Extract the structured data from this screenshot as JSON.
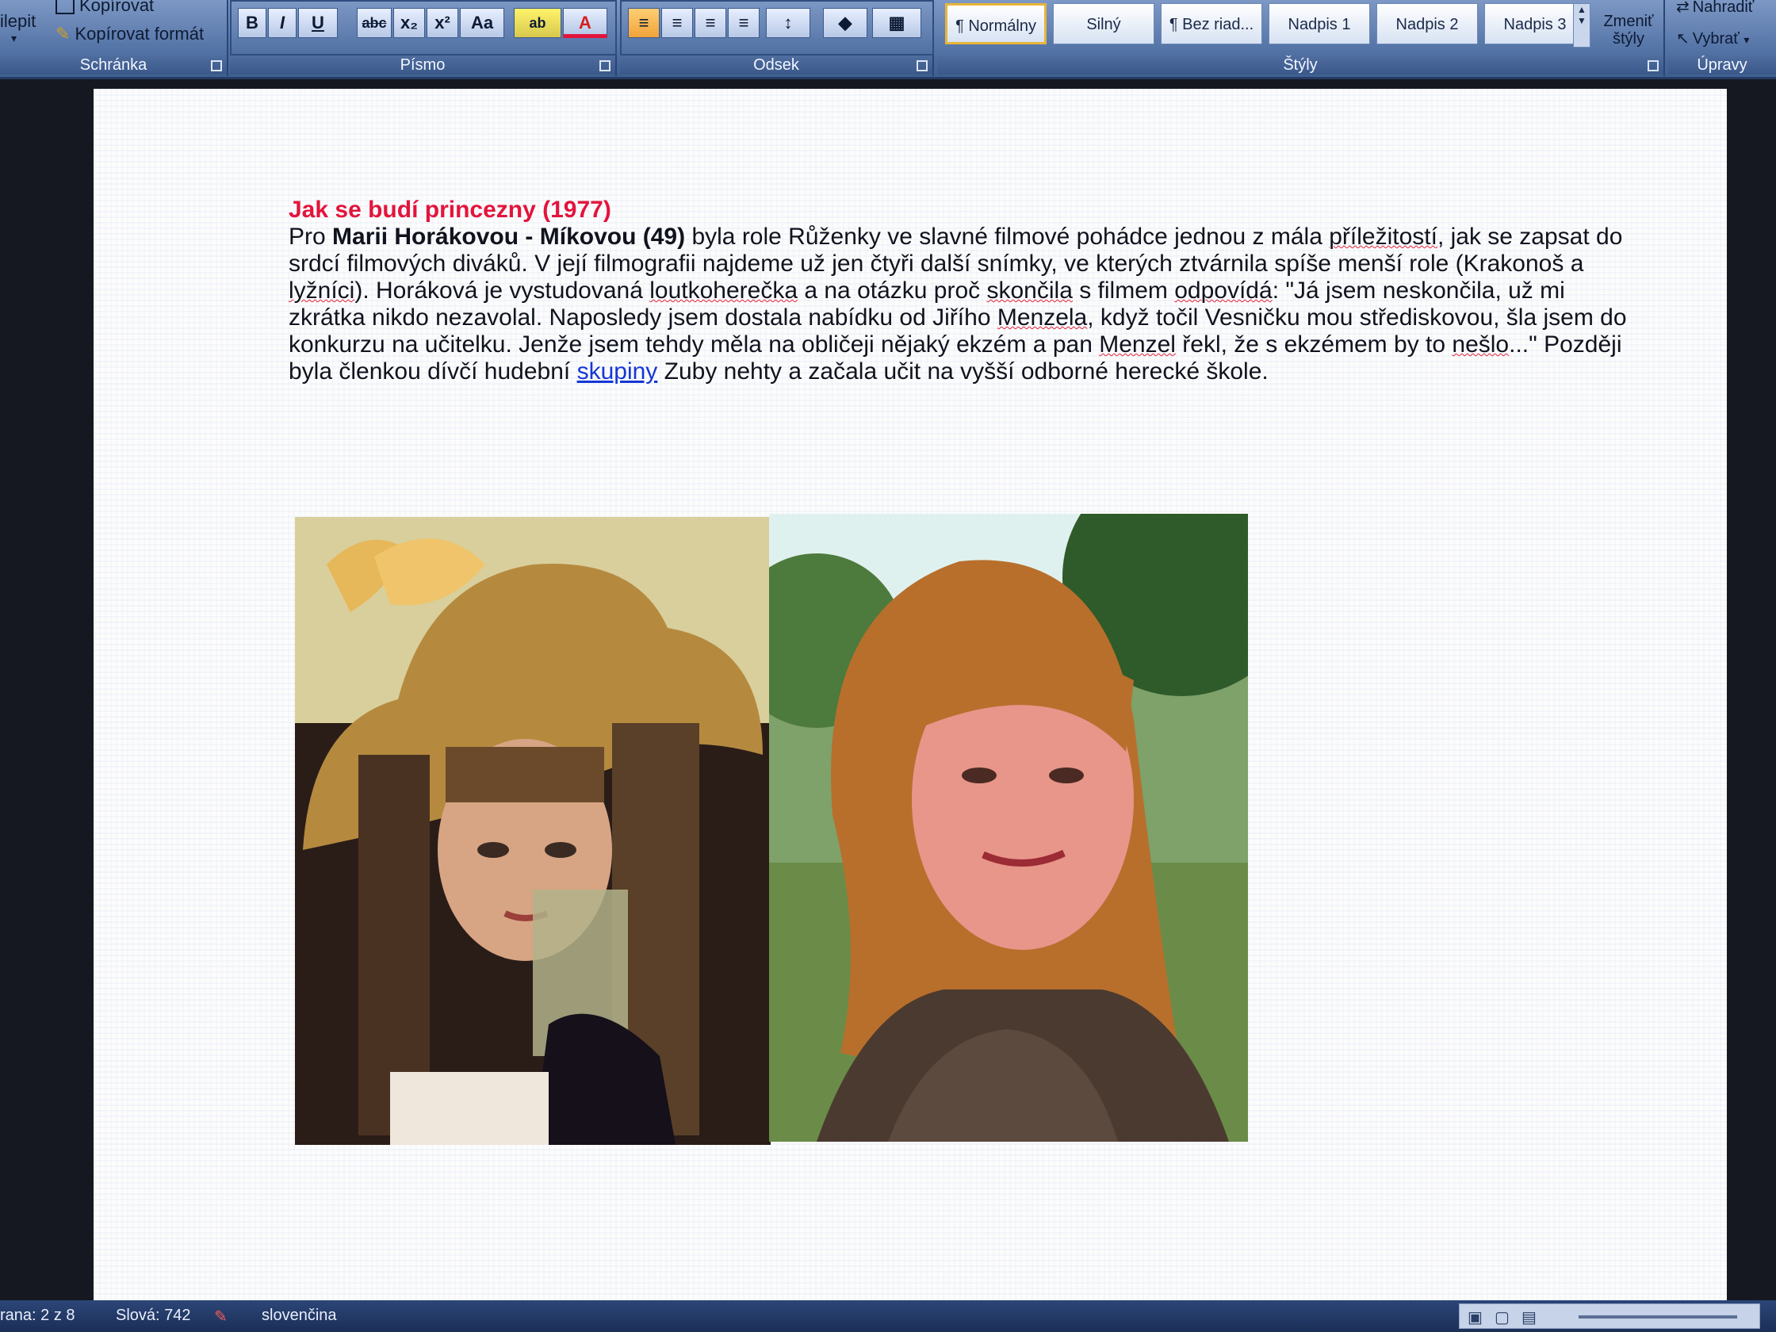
{
  "ribbon": {
    "clipboard": {
      "paste_label": "ilepit",
      "copy_label": "Kopírovat",
      "format_painter_label": "Kopírovat formát",
      "group_label": "Schránka"
    },
    "font": {
      "bold": "B",
      "italic": "I",
      "underline": "U",
      "strikethrough": "abc",
      "subscript": "x₂",
      "superscript": "x²",
      "change_case": "Aa",
      "highlight": "ab",
      "font_color": "A",
      "group_label": "Písmo"
    },
    "paragraph": {
      "group_label": "Odsek"
    },
    "styles": {
      "items": [
        "¶ Normálny",
        "Silný",
        "¶ Bez riad...",
        "Nadpis 1",
        "Nadpis 2",
        "Nadpis 3"
      ],
      "change_styles_label": "Zmeniť štýly",
      "group_label": "Štýly"
    },
    "editing": {
      "replace_label": "Nahradiť",
      "select_label": "Vybrať",
      "group_label": "Úpravy"
    }
  },
  "document": {
    "heading": "Jak se budí princezny (1977)",
    "t1": "Pro ",
    "b1": "Marii Horákovou - Míkovou (49)",
    "t2": " byla role Růženky ve slavné filmové pohádce jednou z mála ",
    "s1": "příležitostí",
    "t3": ", jak se zapsat do srdcí filmových diváků. V její filmografii najdeme už jen čtyři další snímky, ve kterých ztvárnila spíše menší role (Krakonoš a ",
    "s2": "lyžníci",
    "t4": "). Horáková je vystudovaná ",
    "s3": "loutkoherečka",
    "t5": " a na otázku proč ",
    "s4": "skončila",
    "t6": " s filmem ",
    "s5": "odpovídá",
    "t7": ": \"Já jsem neskončila, už mi zkrátka nikdo nezavolal. Naposledy jsem dostala nabídku od Jiřího ",
    "s6": "Menzela",
    "t8": ", když točil Vesničku mou střediskovou, šla jsem do konkurzu na učitelku. Jenže jsem tehdy měla na obličeji nějaký ekzém a pan ",
    "s7": "Menzel",
    "t9": " řekl, že s ekzémem by to ",
    "s8": "nešlo",
    "t10": "...\" Později byla členkou dívčí hudební ",
    "link": "skupiny",
    "t11": " Zuby nehty a začala učit na vyšší odborné herecké škole."
  },
  "statusbar": {
    "page": "rana: 2 z 8",
    "words": "Slová: 742",
    "language": "slovenčina"
  },
  "colors": {
    "heading": "#e3143c",
    "link": "#1437d6",
    "ribbon": "#5a79ab"
  }
}
